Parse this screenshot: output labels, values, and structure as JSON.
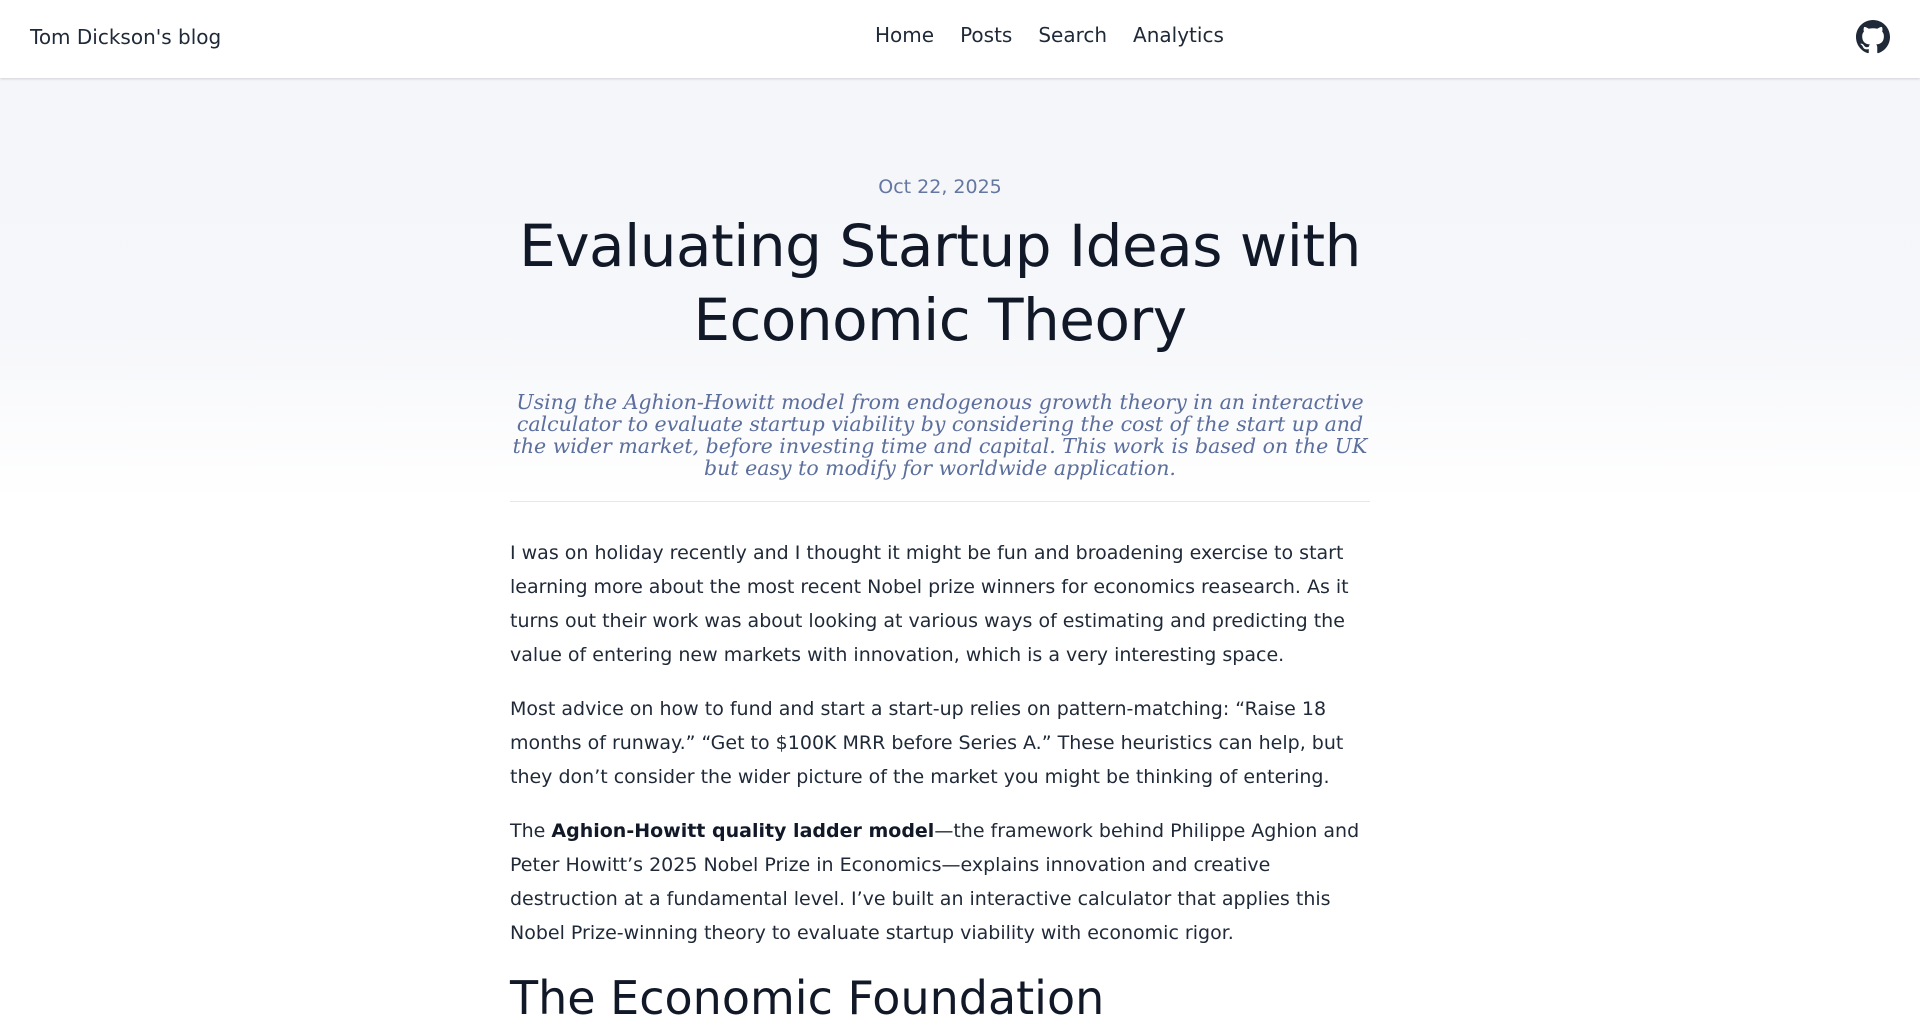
{
  "header": {
    "brand": "Tom Dickson's blog",
    "nav": [
      "Home",
      "Posts",
      "Search",
      "Analytics"
    ],
    "github_icon": "github-icon"
  },
  "post": {
    "date": "Oct 22, 2025",
    "title": "Evaluating Startup Ideas with Economic Theory",
    "subtitle": "Using the Aghion-Howitt model from endogenous growth theory in an interactive calculator to evaluate startup viability by considering the cost of the start up and the wider market, before investing time and capital. This work is based on the UK but easy to modify for worldwide application.",
    "paragraphs": [
      "I was on holiday recently and I thought it might be fun and broadening exercise to start learning more about the most recent Nobel prize winners for economics reasearch. As it turns out their work was about looking at various ways of estimating and predicting the value of entering new markets with innovation, which is a very interesting space.",
      "Most advice on how to fund and start a start-up relies on pattern-matching: “Raise 18 months of runway.” “Get to $100K MRR before Series A.” These heuristics can help, but they don’t consider the wider picture of the market you might be thinking of entering."
    ],
    "p3": {
      "lead": "The ",
      "bold": "Aghion-Howitt quality ladder model",
      "rest": "—the framework behind Philippe Aghion and Peter Howitt’s 2025 Nobel Prize in Economics—explains innovation and creative destruction at a fundamental level. I’ve built an interactive calculator that applies this Nobel Prize-winning theory to evaluate startup viability with economic rigor."
    },
    "section_heading": "The Economic Foundation"
  }
}
